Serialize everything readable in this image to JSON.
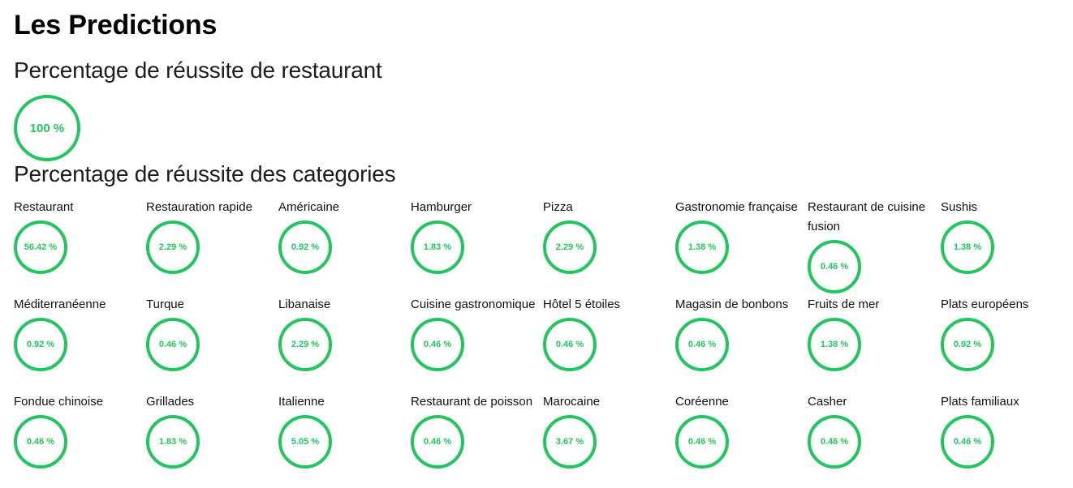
{
  "page": {
    "title": "Les Predictions"
  },
  "restaurant_section": {
    "title": "Percentage de réussite de restaurant",
    "value": "100 %"
  },
  "categories_section": {
    "title": "Percentage de réussite des categories",
    "items": [
      {
        "label": "Restaurant",
        "value": "56.42 %"
      },
      {
        "label": "Restauration rapide",
        "value": "2.29 %"
      },
      {
        "label": "Américaine",
        "value": "0.92 %"
      },
      {
        "label": "Hamburger",
        "value": "1.83 %"
      },
      {
        "label": "Pizza",
        "value": "2.29 %"
      },
      {
        "label": "Gastronomie française",
        "value": "1.38 %"
      },
      {
        "label": "Restaurant de cuisine fusion",
        "value": "0.46 %"
      },
      {
        "label": "Sushis",
        "value": "1.38 %"
      },
      {
        "label": "Méditerranéenne",
        "value": "0.92 %"
      },
      {
        "label": "Turque",
        "value": "0.46 %"
      },
      {
        "label": "Libanaise",
        "value": "2.29 %"
      },
      {
        "label": "Cuisine gastronomique",
        "value": "0.46 %"
      },
      {
        "label": "Hôtel 5 étoiles",
        "value": "0.46 %"
      },
      {
        "label": "Magasin de bonbons",
        "value": "0.46 %"
      },
      {
        "label": "Fruits de mer",
        "value": "1.38 %"
      },
      {
        "label": "Plats européens",
        "value": "0.92 %"
      },
      {
        "label": "Fondue chinoise",
        "value": "0.46 %"
      },
      {
        "label": "Grillades",
        "value": "1.83 %"
      },
      {
        "label": "Italienne",
        "value": "5.05 %"
      },
      {
        "label": "Restaurant de poisson",
        "value": "0.46 %"
      },
      {
        "label": "Marocaine",
        "value": "3.67 %"
      },
      {
        "label": "Coréenne",
        "value": "0.46 %"
      },
      {
        "label": "Casher",
        "value": "0.46 %"
      },
      {
        "label": "Plats familiaux",
        "value": "0.46 %"
      }
    ]
  },
  "colors": {
    "accent": "#22c55e"
  }
}
